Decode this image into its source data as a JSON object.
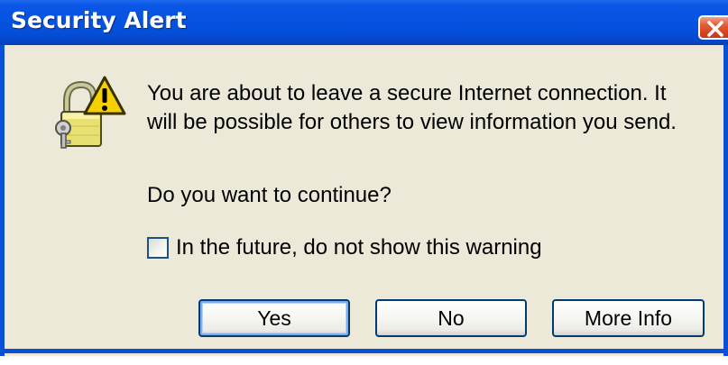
{
  "window": {
    "title": "Security Alert",
    "close_icon": "close-icon"
  },
  "message": {
    "line1": "You are about to leave a secure Internet connection.  It",
    "line2": "will be possible for others to view information you send.",
    "icon": "padlock-warning-icon"
  },
  "question": "Do you want to continue?",
  "checkbox": {
    "label": "In the future, do not show this warning",
    "checked": false
  },
  "buttons": {
    "yes": "Yes",
    "no": "No",
    "more_info": "More Info"
  },
  "colors": {
    "titlebar": "#0653e0",
    "dialog_bg": "#ece9d8",
    "close_button": "#d7451f",
    "button_border": "#003c74"
  }
}
